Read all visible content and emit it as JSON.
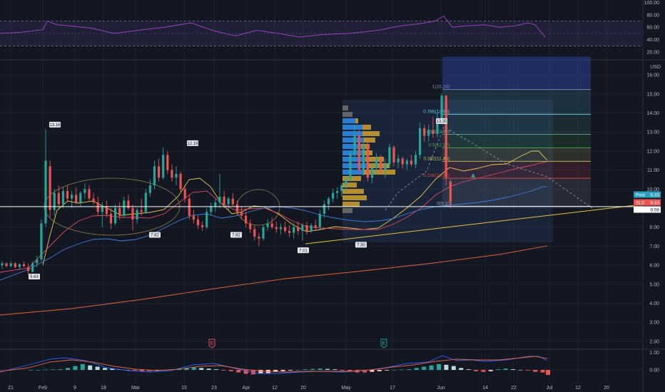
{
  "chart_data": {
    "type": "candlestick",
    "currency": "USD",
    "price_axis_ticks": [
      "16.00",
      "15.00",
      "14.00",
      "13.00",
      "12.00",
      "11.00",
      "10.00",
      "9.00",
      "8.00",
      "7.00",
      "6.00",
      "5.00",
      "4.00",
      "3.00",
      "2.00"
    ],
    "rsi_axis_ticks": [
      "100.00",
      "80.00",
      "60.00",
      "40.00",
      "20.00"
    ],
    "macd_axis_ticks": [
      "1.00",
      "0.00"
    ],
    "date_labels": [
      "21",
      "Feb",
      "9",
      "18",
      "Mar",
      "15",
      "23",
      "Apr",
      "12",
      "20",
      "May",
      "17",
      "Jun",
      "14",
      "22",
      "Jul",
      "12",
      "20"
    ],
    "candles": [
      {
        "date": "21",
        "o": 6.0,
        "h": 6.2,
        "l": 5.8,
        "c": 6.1
      },
      {
        "date": "",
        "o": 6.1,
        "h": 6.15,
        "l": 5.9,
        "c": 5.95
      },
      {
        "date": "",
        "o": 5.95,
        "h": 6.2,
        "l": 5.9,
        "c": 6.1
      },
      {
        "date": "",
        "o": 6.1,
        "h": 6.15,
        "l": 5.85,
        "c": 5.9
      },
      {
        "date": "",
        "o": 5.9,
        "h": 6.1,
        "l": 5.75,
        "c": 6.05
      },
      {
        "date": "",
        "o": 6.05,
        "h": 6.2,
        "l": 5.9,
        "c": 5.95
      },
      {
        "date": "",
        "o": 5.9,
        "h": 6.1,
        "l": 5.5,
        "c": 5.7
      },
      {
        "date": "",
        "o": 5.65,
        "h": 6.2,
        "l": 5.63,
        "c": 6.1
      },
      {
        "date": "",
        "o": 6.1,
        "h": 6.5,
        "l": 5.9,
        "c": 6.3
      },
      {
        "date": "Feb",
        "o": 6.3,
        "h": 8.4,
        "l": 6.2,
        "c": 8.2
      },
      {
        "date": "",
        "o": 8.2,
        "h": 13.16,
        "l": 8.0,
        "c": 11.5
      },
      {
        "date": "",
        "o": 11.2,
        "h": 11.5,
        "l": 8.5,
        "c": 8.9
      },
      {
        "date": "",
        "o": 8.9,
        "h": 10.0,
        "l": 8.6,
        "c": 9.8
      },
      {
        "date": "",
        "o": 9.8,
        "h": 10.2,
        "l": 9.0,
        "c": 9.2
      },
      {
        "date": "9",
        "o": 9.2,
        "h": 10.1,
        "l": 9.0,
        "c": 9.9
      },
      {
        "date": "",
        "o": 9.9,
        "h": 10.2,
        "l": 9.4,
        "c": 9.5
      },
      {
        "date": "",
        "o": 9.5,
        "h": 9.9,
        "l": 9.0,
        "c": 9.7
      },
      {
        "date": "",
        "o": 9.7,
        "h": 10.1,
        "l": 9.2,
        "c": 9.3
      },
      {
        "date": "",
        "o": 9.3,
        "h": 9.9,
        "l": 9.1,
        "c": 9.8
      },
      {
        "date": "",
        "o": 9.8,
        "h": 10.3,
        "l": 9.5,
        "c": 10.0
      },
      {
        "date": "18",
        "o": 10.0,
        "h": 10.2,
        "l": 9.4,
        "c": 9.5
      },
      {
        "date": "",
        "o": 9.5,
        "h": 9.8,
        "l": 9.2,
        "c": 9.3
      },
      {
        "date": "",
        "o": 9.3,
        "h": 9.6,
        "l": 8.6,
        "c": 8.8
      },
      {
        "date": "",
        "o": 8.8,
        "h": 9.3,
        "l": 8.0,
        "c": 9.1
      },
      {
        "date": "",
        "o": 9.1,
        "h": 9.4,
        "l": 8.5,
        "c": 8.7
      },
      {
        "date": "",
        "o": 8.7,
        "h": 9.0,
        "l": 7.9,
        "c": 8.2
      },
      {
        "date": "Mar",
        "o": 8.2,
        "h": 9.2,
        "l": 8.1,
        "c": 9.0
      },
      {
        "date": "",
        "o": 9.0,
        "h": 9.3,
        "l": 8.4,
        "c": 8.6
      },
      {
        "date": "",
        "o": 8.6,
        "h": 9.6,
        "l": 8.5,
        "c": 9.4
      },
      {
        "date": "",
        "o": 9.4,
        "h": 9.7,
        "l": 8.9,
        "c": 9.0
      },
      {
        "date": "",
        "o": 9.0,
        "h": 9.2,
        "l": 7.82,
        "c": 8.4
      },
      {
        "date": "",
        "o": 8.4,
        "h": 9.0,
        "l": 8.2,
        "c": 8.9
      },
      {
        "date": "",
        "o": 8.9,
        "h": 9.5,
        "l": 8.6,
        "c": 8.8
      },
      {
        "date": "",
        "o": 8.8,
        "h": 10.0,
        "l": 8.7,
        "c": 9.8
      },
      {
        "date": "",
        "o": 9.8,
        "h": 10.5,
        "l": 9.6,
        "c": 10.2
      },
      {
        "date": "15",
        "o": 10.2,
        "h": 11.5,
        "l": 10.0,
        "c": 11.2
      },
      {
        "date": "",
        "o": 11.2,
        "h": 11.6,
        "l": 10.4,
        "c": 10.6
      },
      {
        "date": "",
        "o": 10.6,
        "h": 12.19,
        "l": 10.5,
        "c": 11.8
      },
      {
        "date": "",
        "o": 11.8,
        "h": 12.0,
        "l": 10.8,
        "c": 11.0
      },
      {
        "date": "",
        "o": 11.0,
        "h": 11.3,
        "l": 10.4,
        "c": 10.6
      },
      {
        "date": "",
        "o": 10.6,
        "h": 11.2,
        "l": 10.2,
        "c": 10.8
      },
      {
        "date": "23",
        "o": 10.8,
        "h": 10.9,
        "l": 9.8,
        "c": 10.0
      },
      {
        "date": "",
        "o": 10.0,
        "h": 10.2,
        "l": 9.3,
        "c": 9.5
      },
      {
        "date": "",
        "o": 9.5,
        "h": 9.7,
        "l": 8.4,
        "c": 8.6
      },
      {
        "date": "",
        "o": 8.6,
        "h": 8.9,
        "l": 8.2,
        "c": 8.4
      },
      {
        "date": "",
        "o": 8.4,
        "h": 8.6,
        "l": 7.9,
        "c": 8.1
      },
      {
        "date": "",
        "o": 8.1,
        "h": 8.3,
        "l": 7.82,
        "c": 8.0
      },
      {
        "date": "",
        "o": 8.0,
        "h": 9.0,
        "l": 7.9,
        "c": 8.8
      },
      {
        "date": "Apr",
        "o": 8.8,
        "h": 9.3,
        "l": 8.6,
        "c": 9.1
      },
      {
        "date": "",
        "o": 9.1,
        "h": 9.5,
        "l": 8.8,
        "c": 9.3
      },
      {
        "date": "",
        "o": 9.3,
        "h": 10.8,
        "l": 9.0,
        "c": 9.6
      },
      {
        "date": "",
        "o": 9.6,
        "h": 9.9,
        "l": 9.0,
        "c": 9.2
      },
      {
        "date": "",
        "o": 9.2,
        "h": 9.6,
        "l": 8.9,
        "c": 9.5
      },
      {
        "date": "",
        "o": 9.5,
        "h": 9.8,
        "l": 9.1,
        "c": 9.2
      },
      {
        "date": "12",
        "o": 9.2,
        "h": 9.4,
        "l": 8.6,
        "c": 8.8
      },
      {
        "date": "",
        "o": 8.8,
        "h": 9.1,
        "l": 8.4,
        "c": 8.6
      },
      {
        "date": "",
        "o": 8.6,
        "h": 8.8,
        "l": 8.0,
        "c": 8.2
      },
      {
        "date": "",
        "o": 8.2,
        "h": 8.4,
        "l": 7.7,
        "c": 7.9
      },
      {
        "date": "",
        "o": 7.9,
        "h": 8.1,
        "l": 7.3,
        "c": 7.5
      },
      {
        "date": "20",
        "o": 7.5,
        "h": 7.7,
        "l": 7.01,
        "c": 7.4
      },
      {
        "date": "",
        "o": 7.4,
        "h": 8.1,
        "l": 7.3,
        "c": 8.0
      },
      {
        "date": "",
        "o": 8.0,
        "h": 8.4,
        "l": 7.8,
        "c": 8.2
      },
      {
        "date": "",
        "o": 8.2,
        "h": 8.5,
        "l": 7.9,
        "c": 8.0
      },
      {
        "date": "",
        "o": 8.0,
        "h": 8.3,
        "l": 7.7,
        "c": 7.9
      },
      {
        "date": "",
        "o": 7.9,
        "h": 8.2,
        "l": 7.6,
        "c": 8.0
      },
      {
        "date": "May",
        "o": 8.0,
        "h": 8.3,
        "l": 7.7,
        "c": 7.8
      },
      {
        "date": "",
        "o": 7.8,
        "h": 8.1,
        "l": 7.5,
        "c": 7.7
      },
      {
        "date": "",
        "o": 7.7,
        "h": 8.2,
        "l": 7.4,
        "c": 8.0
      },
      {
        "date": "",
        "o": 8.0,
        "h": 8.3,
        "l": 7.6,
        "c": 7.8
      },
      {
        "date": "",
        "o": 7.8,
        "h": 8.2,
        "l": 7.3,
        "c": 8.1
      },
      {
        "date": "",
        "o": 8.1,
        "h": 8.3,
        "l": 7.6,
        "c": 7.8
      },
      {
        "date": "",
        "o": 7.8,
        "h": 8.2,
        "l": 7.7,
        "c": 8.1
      },
      {
        "date": "17",
        "o": 8.1,
        "h": 8.4,
        "l": 7.8,
        "c": 8.0
      },
      {
        "date": "",
        "o": 8.0,
        "h": 8.9,
        "l": 7.9,
        "c": 8.7
      },
      {
        "date": "",
        "o": 8.7,
        "h": 9.4,
        "l": 8.5,
        "c": 9.2
      },
      {
        "date": "",
        "o": 9.2,
        "h": 9.6,
        "l": 8.9,
        "c": 9.5
      },
      {
        "date": "",
        "o": 9.5,
        "h": 10.0,
        "l": 9.3,
        "c": 9.8
      },
      {
        "date": "",
        "o": 9.8,
        "h": 10.1,
        "l": 9.5,
        "c": 9.9
      },
      {
        "date": "",
        "o": 9.9,
        "h": 10.3,
        "l": 9.6,
        "c": 10.2
      },
      {
        "date": "",
        "o": 10.2,
        "h": 10.7,
        "l": 9.9,
        "c": 10.5
      },
      {
        "date": "",
        "o": 10.5,
        "h": 12.0,
        "l": 10.4,
        "c": 11.8
      },
      {
        "date": "Jun",
        "o": 11.8,
        "h": 13.35,
        "l": 11.5,
        "c": 12.8
      },
      {
        "date": "",
        "o": 12.8,
        "h": 13.1,
        "l": 10.8,
        "c": 11.0
      },
      {
        "date": "",
        "o": 11.0,
        "h": 12.6,
        "l": 10.7,
        "c": 12.3
      },
      {
        "date": "",
        "o": 12.3,
        "h": 12.6,
        "l": 10.4,
        "c": 10.6
      },
      {
        "date": "",
        "o": 10.6,
        "h": 11.3,
        "l": 10.3,
        "c": 11.1
      },
      {
        "date": "",
        "o": 11.1,
        "h": 11.9,
        "l": 10.8,
        "c": 11.6
      },
      {
        "date": "",
        "o": 11.6,
        "h": 11.8,
        "l": 10.8,
        "c": 11.0
      },
      {
        "date": "",
        "o": 11.0,
        "h": 11.6,
        "l": 10.6,
        "c": 11.3
      },
      {
        "date": "14",
        "o": 11.3,
        "h": 12.4,
        "l": 11.1,
        "c": 12.2
      },
      {
        "date": "",
        "o": 12.2,
        "h": 12.3,
        "l": 11.2,
        "c": 11.4
      },
      {
        "date": "",
        "o": 11.4,
        "h": 11.8,
        "l": 11.1,
        "c": 11.6
      },
      {
        "date": "",
        "o": 11.6,
        "h": 11.7,
        "l": 11.1,
        "c": 11.3
      },
      {
        "date": "",
        "o": 11.3,
        "h": 11.6,
        "l": 11.0,
        "c": 11.5
      },
      {
        "date": "",
        "o": 11.5,
        "h": 11.8,
        "l": 11.2,
        "c": 11.3
      },
      {
        "date": "22",
        "o": 11.3,
        "h": 12.0,
        "l": 11.1,
        "c": 11.8
      },
      {
        "date": "",
        "o": 11.8,
        "h": 13.5,
        "l": 11.6,
        "c": 13.2
      },
      {
        "date": "",
        "o": 13.2,
        "h": 13.4,
        "l": 12.5,
        "c": 12.8
      },
      {
        "date": "",
        "o": 12.8,
        "h": 13.4,
        "l": 12.5,
        "c": 13.1
      },
      {
        "date": "",
        "o": 13.1,
        "h": 13.8,
        "l": 12.7,
        "c": 12.9
      },
      {
        "date": "",
        "o": 12.9,
        "h": 14.0,
        "l": 12.7,
        "c": 13.7
      },
      {
        "date": "",
        "o": 13.7,
        "h": 15.0,
        "l": 13.5,
        "c": 14.9
      },
      {
        "date": "",
        "o": 14.9,
        "h": 14.95,
        "l": 10.2,
        "c": 10.6
      },
      {
        "date": "",
        "o": 10.4,
        "h": 10.5,
        "l": 9.0,
        "c": 9.33
      }
    ],
    "moving_averages": [
      {
        "name": "",
        "color": "#e6c84a"
      },
      {
        "name": "",
        "color": "#e04660"
      },
      {
        "name": "",
        "color": "#3b7ddd"
      },
      {
        "name": "",
        "color": "#e8623a"
      }
    ],
    "fib_levels": [
      {
        "label": "1(15.24)",
        "value": 15.24,
        "color": "#7a8ab8"
      },
      {
        "label": "0.786(13.93)",
        "value": 13.93,
        "color": "#63c5e0"
      },
      {
        "label": "0.618(12.88)",
        "value": 12.88,
        "color": "#57a894"
      },
      {
        "label": "0.5(12.17)",
        "value": 12.17,
        "color": "#4caf50"
      },
      {
        "label": "0.382(11.46)",
        "value": 11.46,
        "color": "#c7c95a"
      },
      {
        "label": "0.236(10.57)",
        "value": 10.57,
        "color": "#e04a4a"
      },
      {
        "label": "0(9.10)",
        "value": 9.1,
        "color": "#9aa0ad"
      }
    ],
    "annotations": [
      {
        "text": "13.16",
        "value": 13.16
      },
      {
        "text": "5.63",
        "value": 5.63
      },
      {
        "text": "12.19",
        "value": 12.19
      },
      {
        "text": "7.82",
        "value": 7.82
      },
      {
        "text": "7.82",
        "value": 7.82
      },
      {
        "text": "7.01",
        "value": 7.01
      },
      {
        "text": "7.30",
        "value": 7.3
      },
      {
        "text": "13.35",
        "value": 13.35
      }
    ],
    "price_badges": [
      {
        "text": "Post",
        "value": "9.33",
        "color": "#2a9fbf"
      },
      {
        "text": "SLS",
        "value": "9.33",
        "color": "#ef5350"
      },
      {
        "text": "",
        "value": "9.08",
        "color": "#ffffff"
      }
    ],
    "event_markers": [
      {
        "text": "E",
        "color": "#ef5350"
      },
      {
        "text": "E",
        "color": "#26a69a"
      }
    ],
    "rsi_levels": [
      70,
      30
    ]
  }
}
